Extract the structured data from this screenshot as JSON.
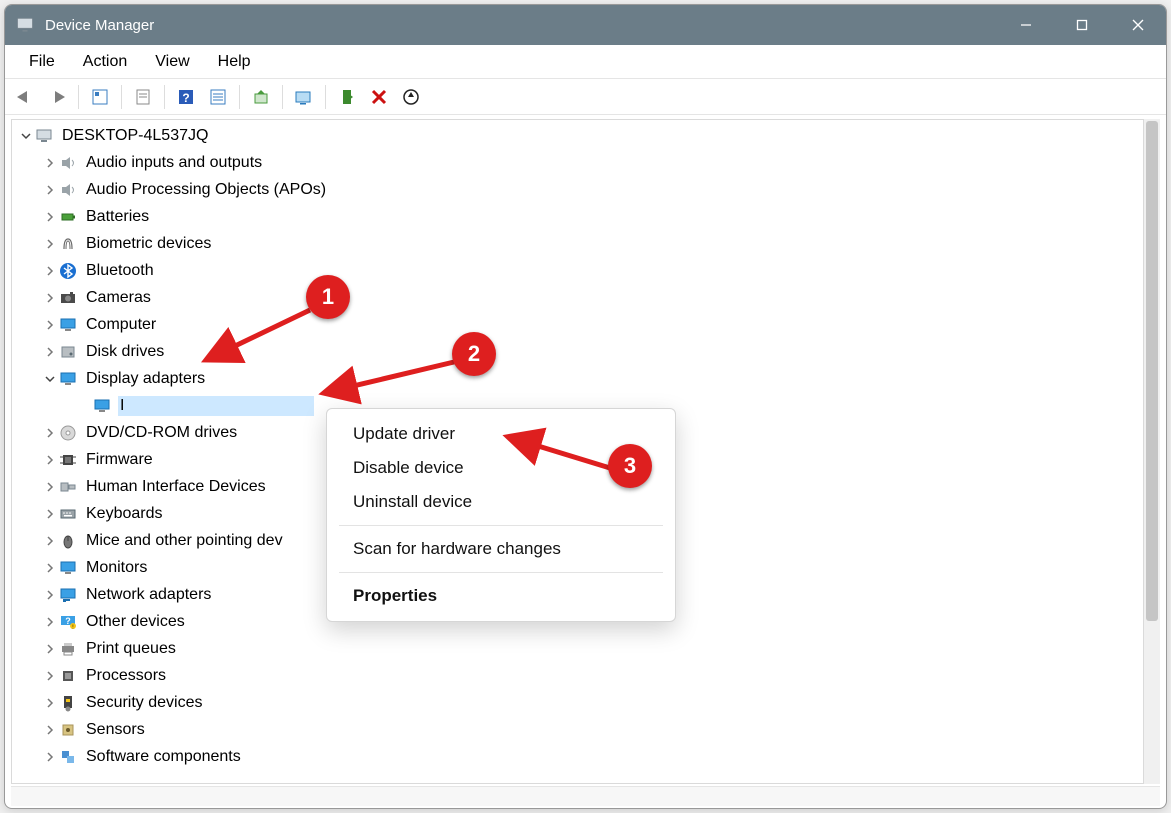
{
  "window": {
    "title": "Device Manager"
  },
  "menubar": [
    "File",
    "Action",
    "View",
    "Help"
  ],
  "toolbar_icons": [
    "back-icon",
    "forward-icon",
    "show-hidden-icon",
    "properties-icon",
    "help-icon",
    "view-menu-icon",
    "update-driver-icon",
    "scan-hardware-icon",
    "enable-icon",
    "disable-icon",
    "uninstall-icon"
  ],
  "tree": {
    "root": "DESKTOP-4L537JQ",
    "children": [
      {
        "label": "Audio inputs and outputs",
        "icon": "speaker"
      },
      {
        "label": "Audio Processing Objects (APOs)",
        "icon": "speaker"
      },
      {
        "label": "Batteries",
        "icon": "battery"
      },
      {
        "label": "Biometric devices",
        "icon": "fingerprint"
      },
      {
        "label": "Bluetooth",
        "icon": "bluetooth"
      },
      {
        "label": "Cameras",
        "icon": "camera"
      },
      {
        "label": "Computer",
        "icon": "monitor"
      },
      {
        "label": "Disk drives",
        "icon": "disk"
      },
      {
        "label": "Display adapters",
        "icon": "monitor",
        "expanded": true,
        "children": [
          {
            "label": "I",
            "icon": "monitor",
            "selected": true
          }
        ]
      },
      {
        "label": "DVD/CD-ROM drives",
        "icon": "cd"
      },
      {
        "label": "Firmware",
        "icon": "chip"
      },
      {
        "label": "Human Interface Devices",
        "icon": "hid"
      },
      {
        "label": "Keyboards",
        "icon": "keyboard"
      },
      {
        "label": "Mice and other pointing dev",
        "icon": "mouse"
      },
      {
        "label": "Monitors",
        "icon": "monitor"
      },
      {
        "label": "Network adapters",
        "icon": "network"
      },
      {
        "label": "Other devices",
        "icon": "question"
      },
      {
        "label": "Print queues",
        "icon": "printer"
      },
      {
        "label": "Processors",
        "icon": "cpu"
      },
      {
        "label": "Security devices",
        "icon": "security"
      },
      {
        "label": "Sensors",
        "icon": "sensor"
      },
      {
        "label": "Software components",
        "icon": "software"
      }
    ]
  },
  "context_menu": {
    "items": [
      {
        "label": "Update driver"
      },
      {
        "label": "Disable device"
      },
      {
        "label": "Uninstall device"
      },
      {
        "sep": true
      },
      {
        "label": "Scan for hardware changes"
      },
      {
        "sep": true
      },
      {
        "label": "Properties",
        "bold": true
      }
    ]
  },
  "annotations": {
    "marker1": "1",
    "marker2": "2",
    "marker3": "3"
  }
}
